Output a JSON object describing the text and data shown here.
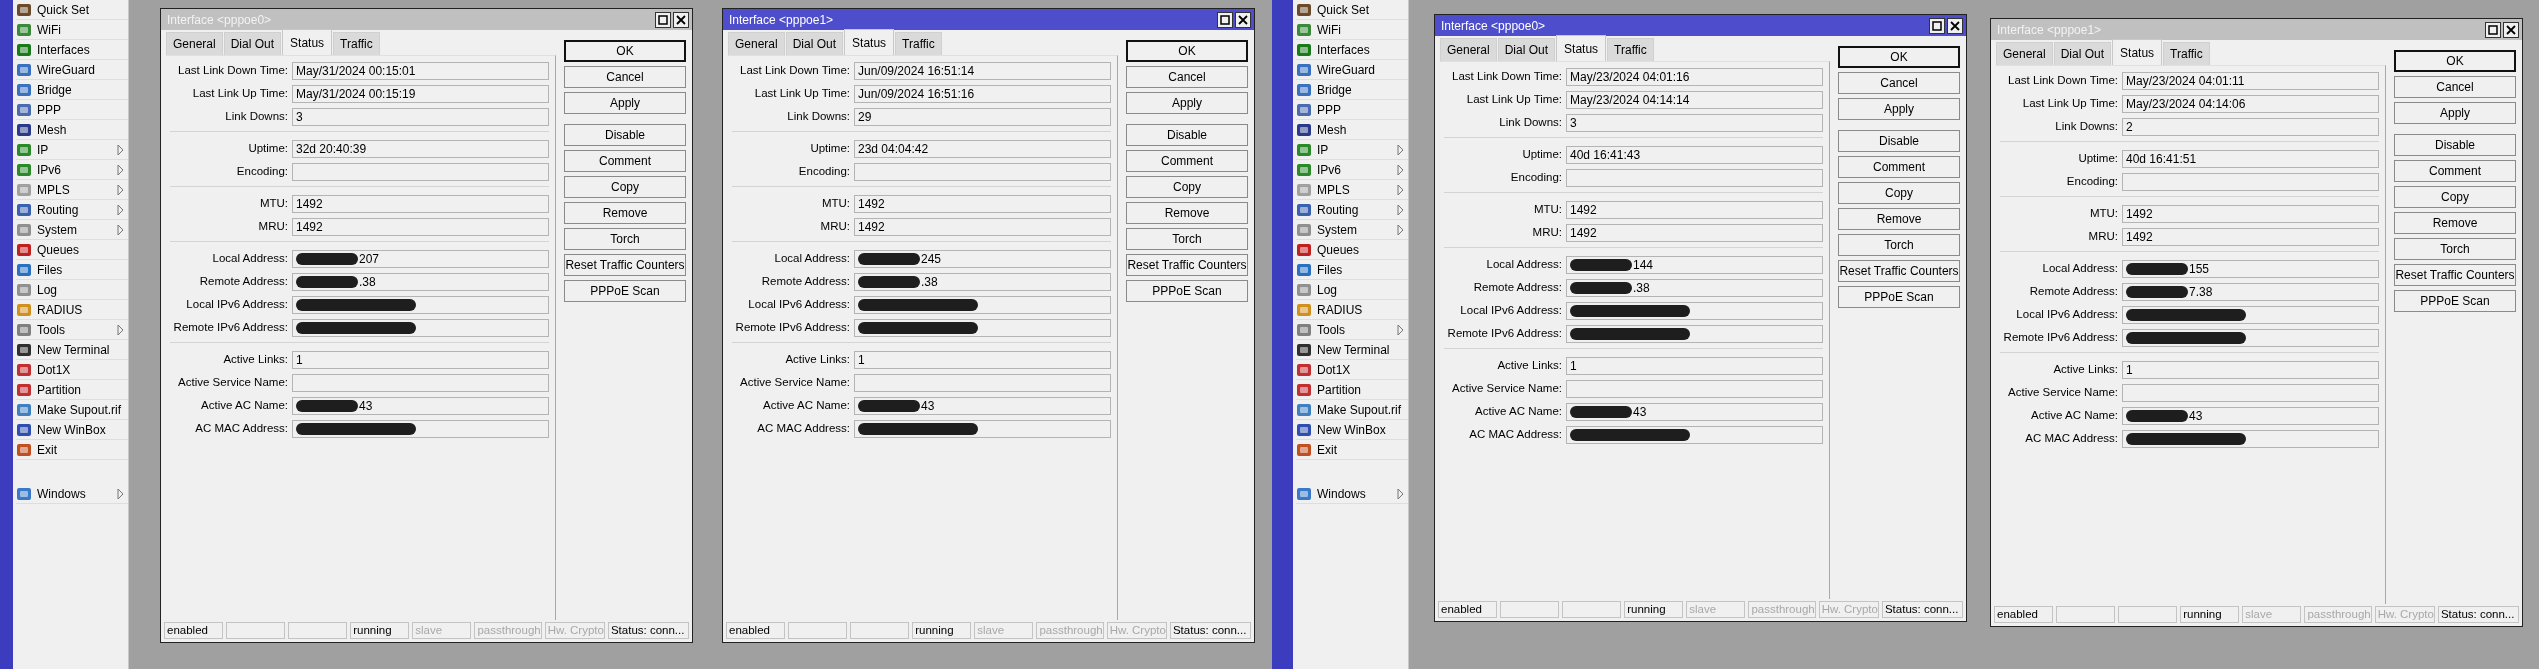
{
  "screens": [
    {
      "sidebar": {
        "items": [
          {
            "label": "Quick Set",
            "submenu": false
          },
          {
            "label": "WiFi",
            "submenu": false
          },
          {
            "label": "Interfaces",
            "submenu": false
          },
          {
            "label": "WireGuard",
            "submenu": false
          },
          {
            "label": "Bridge",
            "submenu": false
          },
          {
            "label": "PPP",
            "submenu": false
          },
          {
            "label": "Mesh",
            "submenu": false
          },
          {
            "label": "IP",
            "submenu": true
          },
          {
            "label": "IPv6",
            "submenu": true
          },
          {
            "label": "MPLS",
            "submenu": true
          },
          {
            "label": "Routing",
            "submenu": true
          },
          {
            "label": "System",
            "submenu": true
          },
          {
            "label": "Queues",
            "submenu": false
          },
          {
            "label": "Files",
            "submenu": false
          },
          {
            "label": "Log",
            "submenu": false
          },
          {
            "label": "RADIUS",
            "submenu": false
          },
          {
            "label": "Tools",
            "submenu": true
          },
          {
            "label": "New Terminal",
            "submenu": false
          },
          {
            "label": "Dot1X",
            "submenu": false
          },
          {
            "label": "Partition",
            "submenu": false
          },
          {
            "label": "Make Supout.rif",
            "submenu": false
          },
          {
            "label": "New WinBox",
            "submenu": false
          },
          {
            "label": "Exit",
            "submenu": false
          }
        ],
        "bottom_items": [
          {
            "label": "Windows",
            "submenu": true
          }
        ]
      },
      "windows": [
        {
          "title": "Interface <pppoe0>",
          "active": false,
          "tabs": [
            {
              "label": "General",
              "selected": false
            },
            {
              "label": "Dial Out",
              "selected": false
            },
            {
              "label": "Status",
              "selected": true
            },
            {
              "label": "Traffic",
              "selected": false
            }
          ],
          "groups": [
            [
              {
                "label": "Last Link Down Time:",
                "value": "May/31/2024 00:15:01"
              },
              {
                "label": "Last Link Up Time:",
                "value": "May/31/2024 00:15:19"
              },
              {
                "label": "Link Downs:",
                "value": "3"
              }
            ],
            [
              {
                "label": "Uptime:",
                "value": "32d 20:40:39"
              },
              {
                "label": "Encoding:"
              }
            ],
            [
              {
                "label": "MTU:",
                "value": "1492"
              },
              {
                "label": "MRU:",
                "value": "1492"
              }
            ],
            [
              {
                "label": "Local Address:",
                "value": "207",
                "redacted": true
              },
              {
                "label": "Remote Address:",
                "value": ".38",
                "redacted": true
              },
              {
                "label": "Local IPv6 Address:",
                "redacted": true
              },
              {
                "label": "Remote IPv6 Address:",
                "redacted": true
              }
            ],
            [
              {
                "label": "Active Links:",
                "value": "1"
              },
              {
                "label": "Active Service Name:"
              },
              {
                "label": "Active AC Name:",
                "value": "43",
                "redacted": true
              },
              {
                "label": "AC MAC Address:",
                "redacted": true
              }
            ]
          ],
          "button_groups": [
            [
              {
                "label": "OK",
                "default": true
              },
              {
                "label": "Cancel",
                "default": false
              },
              {
                "label": "Apply",
                "default": false
              }
            ],
            [
              {
                "label": "Disable",
                "default": false
              },
              {
                "label": "Comment",
                "default": false
              },
              {
                "label": "Copy",
                "default": false
              },
              {
                "label": "Remove",
                "default": false
              },
              {
                "label": "Torch",
                "default": false
              },
              {
                "label": "Reset Traffic Counters",
                "default": false
              },
              {
                "label": "PPPoE Scan",
                "default": false
              }
            ]
          ],
          "status_bar": [
            {
              "kind": "text",
              "text": "enabled",
              "dim": false
            },
            {
              "kind": "blank"
            },
            {
              "kind": "blank"
            },
            {
              "kind": "text",
              "text": "running",
              "dim": false
            },
            {
              "kind": "text",
              "text": "slave",
              "dim": true
            },
            {
              "kind": "text",
              "text": "passthrough",
              "dim": true
            },
            {
              "kind": "text",
              "text": "Hw. Crypto",
              "dim": true
            },
            {
              "kind": "text",
              "text": "Status: conn...",
              "dim": false
            }
          ]
        },
        {
          "title": "Interface <pppoe1>",
          "active": true,
          "tabs": [
            {
              "label": "General",
              "selected": false
            },
            {
              "label": "Dial Out",
              "selected": false
            },
            {
              "label": "Status",
              "selected": true
            },
            {
              "label": "Traffic",
              "selected": false
            }
          ],
          "groups": [
            [
              {
                "label": "Last Link Down Time:",
                "value": "Jun/09/2024 16:51:14"
              },
              {
                "label": "Last Link Up Time:",
                "value": "Jun/09/2024 16:51:16"
              },
              {
                "label": "Link Downs:",
                "value": "29"
              }
            ],
            [
              {
                "label": "Uptime:",
                "value": "23d 04:04:42"
              },
              {
                "label": "Encoding:"
              }
            ],
            [
              {
                "label": "MTU:",
                "value": "1492"
              },
              {
                "label": "MRU:",
                "value": "1492"
              }
            ],
            [
              {
                "label": "Local Address:",
                "value": "245",
                "redacted": true
              },
              {
                "label": "Remote Address:",
                "value": ".38",
                "redacted": true
              },
              {
                "label": "Local IPv6 Address:",
                "redacted": true
              },
              {
                "label": "Remote IPv6 Address:",
                "redacted": true
              }
            ],
            [
              {
                "label": "Active Links:",
                "value": "1"
              },
              {
                "label": "Active Service Name:"
              },
              {
                "label": "Active AC Name:",
                "value": "43",
                "redacted": true
              },
              {
                "label": "AC MAC Address:",
                "redacted": true
              }
            ]
          ],
          "button_groups": [
            [
              {
                "label": "OK",
                "default": true
              },
              {
                "label": "Cancel",
                "default": false
              },
              {
                "label": "Apply",
                "default": false
              }
            ],
            [
              {
                "label": "Disable",
                "default": false
              },
              {
                "label": "Comment",
                "default": false
              },
              {
                "label": "Copy",
                "default": false
              },
              {
                "label": "Remove",
                "default": false
              },
              {
                "label": "Torch",
                "default": false
              },
              {
                "label": "Reset Traffic Counters",
                "default": false
              },
              {
                "label": "PPPoE Scan",
                "default": false
              }
            ]
          ],
          "status_bar": [
            {
              "kind": "text",
              "text": "enabled",
              "dim": false
            },
            {
              "kind": "blank"
            },
            {
              "kind": "blank"
            },
            {
              "kind": "text",
              "text": "running",
              "dim": false
            },
            {
              "kind": "text",
              "text": "slave",
              "dim": true
            },
            {
              "kind": "text",
              "text": "passthrough",
              "dim": true
            },
            {
              "kind": "text",
              "text": "Hw. Crypto",
              "dim": true
            },
            {
              "kind": "text",
              "text": "Status: conn...",
              "dim": false
            }
          ]
        }
      ]
    },
    {
      "sidebar": {
        "items": [
          {
            "label": "Quick Set",
            "submenu": false
          },
          {
            "label": "WiFi",
            "submenu": false
          },
          {
            "label": "Interfaces",
            "submenu": false
          },
          {
            "label": "WireGuard",
            "submenu": false
          },
          {
            "label": "Bridge",
            "submenu": false
          },
          {
            "label": "PPP",
            "submenu": false
          },
          {
            "label": "Mesh",
            "submenu": false
          },
          {
            "label": "IP",
            "submenu": true
          },
          {
            "label": "IPv6",
            "submenu": true
          },
          {
            "label": "MPLS",
            "submenu": true
          },
          {
            "label": "Routing",
            "submenu": true
          },
          {
            "label": "System",
            "submenu": true
          },
          {
            "label": "Queues",
            "submenu": false
          },
          {
            "label": "Files",
            "submenu": false
          },
          {
            "label": "Log",
            "submenu": false
          },
          {
            "label": "RADIUS",
            "submenu": false
          },
          {
            "label": "Tools",
            "submenu": true
          },
          {
            "label": "New Terminal",
            "submenu": false
          },
          {
            "label": "Dot1X",
            "submenu": false
          },
          {
            "label": "Partition",
            "submenu": false
          },
          {
            "label": "Make Supout.rif",
            "submenu": false
          },
          {
            "label": "New WinBox",
            "submenu": false
          },
          {
            "label": "Exit",
            "submenu": false
          }
        ],
        "bottom_items": [
          {
            "label": "Windows",
            "submenu": true
          }
        ]
      },
      "windows": [
        {
          "title": "Interface <pppoe0>",
          "active": true,
          "tabs": [
            {
              "label": "General",
              "selected": false
            },
            {
              "label": "Dial Out",
              "selected": false
            },
            {
              "label": "Status",
              "selected": true
            },
            {
              "label": "Traffic",
              "selected": false
            }
          ],
          "groups": [
            [
              {
                "label": "Last Link Down Time:",
                "value": "May/23/2024 04:01:16"
              },
              {
                "label": "Last Link Up Time:",
                "value": "May/23/2024 04:14:14"
              },
              {
                "label": "Link Downs:",
                "value": "3"
              }
            ],
            [
              {
                "label": "Uptime:",
                "value": "40d 16:41:43"
              },
              {
                "label": "Encoding:"
              }
            ],
            [
              {
                "label": "MTU:",
                "value": "1492"
              },
              {
                "label": "MRU:",
                "value": "1492"
              }
            ],
            [
              {
                "label": "Local Address:",
                "value": "144",
                "redacted": true
              },
              {
                "label": "Remote Address:",
                "value": ".38",
                "redacted": true
              },
              {
                "label": "Local IPv6 Address:",
                "redacted": true
              },
              {
                "label": "Remote IPv6 Address:",
                "redacted": true
              }
            ],
            [
              {
                "label": "Active Links:",
                "value": "1"
              },
              {
                "label": "Active Service Name:"
              },
              {
                "label": "Active AC Name:",
                "value": "43",
                "redacted": true
              },
              {
                "label": "AC MAC Address:",
                "redacted": true
              }
            ]
          ],
          "button_groups": [
            [
              {
                "label": "OK",
                "default": true
              },
              {
                "label": "Cancel",
                "default": false
              },
              {
                "label": "Apply",
                "default": false
              }
            ],
            [
              {
                "label": "Disable",
                "default": false
              },
              {
                "label": "Comment",
                "default": false
              },
              {
                "label": "Copy",
                "default": false
              },
              {
                "label": "Remove",
                "default": false
              },
              {
                "label": "Torch",
                "default": false
              },
              {
                "label": "Reset Traffic Counters",
                "default": false
              },
              {
                "label": "PPPoE Scan",
                "default": false
              }
            ]
          ],
          "status_bar": [
            {
              "kind": "text",
              "text": "enabled",
              "dim": false
            },
            {
              "kind": "blank"
            },
            {
              "kind": "blank"
            },
            {
              "kind": "text",
              "text": "running",
              "dim": false
            },
            {
              "kind": "text",
              "text": "slave",
              "dim": true
            },
            {
              "kind": "text",
              "text": "passthrough",
              "dim": true
            },
            {
              "kind": "text",
              "text": "Hw. Crypto",
              "dim": true
            },
            {
              "kind": "text",
              "text": "Status: conn...",
              "dim": false
            }
          ]
        },
        {
          "title": "Interface <pppoe1>",
          "active": false,
          "tabs": [
            {
              "label": "General",
              "selected": false
            },
            {
              "label": "Dial Out",
              "selected": false
            },
            {
              "label": "Status",
              "selected": true
            },
            {
              "label": "Traffic",
              "selected": false
            }
          ],
          "groups": [
            [
              {
                "label": "Last Link Down Time:",
                "value": "May/23/2024 04:01:11"
              },
              {
                "label": "Last Link Up Time:",
                "value": "May/23/2024 04:14:06"
              },
              {
                "label": "Link Downs:",
                "value": "2"
              }
            ],
            [
              {
                "label": "Uptime:",
                "value": "40d 16:41:51"
              },
              {
                "label": "Encoding:"
              }
            ],
            [
              {
                "label": "MTU:",
                "value": "1492"
              },
              {
                "label": "MRU:",
                "value": "1492"
              }
            ],
            [
              {
                "label": "Local Address:",
                "value": "155",
                "redacted": true
              },
              {
                "label": "Remote Address:",
                "value": "7.38",
                "redacted": true
              },
              {
                "label": "Local IPv6 Address:",
                "redacted": true
              },
              {
                "label": "Remote IPv6 Address:",
                "redacted": true
              }
            ],
            [
              {
                "label": "Active Links:",
                "value": "1"
              },
              {
                "label": "Active Service Name:"
              },
              {
                "label": "Active AC Name:",
                "value": "43",
                "redacted": true
              },
              {
                "label": "AC MAC Address:",
                "redacted": true
              }
            ]
          ],
          "button_groups": [
            [
              {
                "label": "OK",
                "default": true
              },
              {
                "label": "Cancel",
                "default": false
              },
              {
                "label": "Apply",
                "default": false
              }
            ],
            [
              {
                "label": "Disable",
                "default": false
              },
              {
                "label": "Comment",
                "default": false
              },
              {
                "label": "Copy",
                "default": false
              },
              {
                "label": "Remove",
                "default": false
              },
              {
                "label": "Torch",
                "default": false
              },
              {
                "label": "Reset Traffic Counters",
                "default": false
              },
              {
                "label": "PPPoE Scan",
                "default": false
              }
            ]
          ],
          "status_bar": [
            {
              "kind": "text",
              "text": "enabled",
              "dim": false
            },
            {
              "kind": "blank"
            },
            {
              "kind": "blank"
            },
            {
              "kind": "text",
              "text": "running",
              "dim": false
            },
            {
              "kind": "text",
              "text": "slave",
              "dim": true
            },
            {
              "kind": "text",
              "text": "passthrough",
              "dim": true
            },
            {
              "kind": "text",
              "text": "Hw. Crypto",
              "dim": true
            },
            {
              "kind": "text",
              "text": "Status: conn...",
              "dim": false
            }
          ]
        }
      ]
    }
  ]
}
